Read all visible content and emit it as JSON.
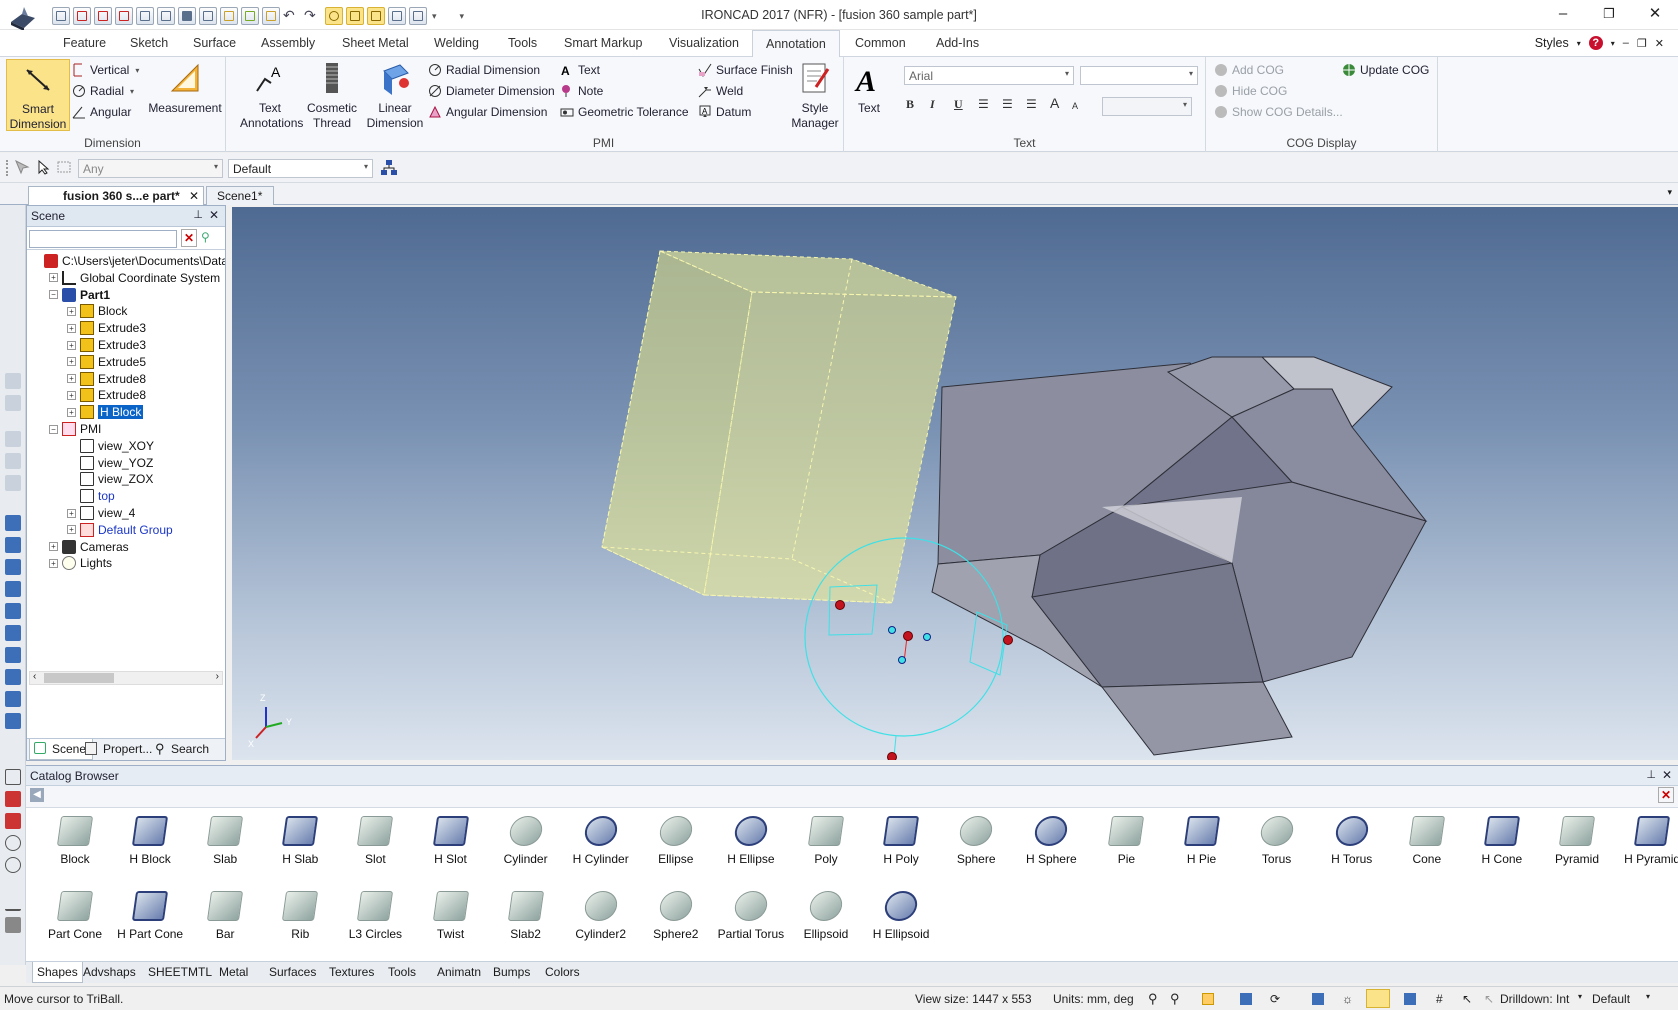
{
  "window": {
    "title": "IRONCAD 2017 (NFR) - [fusion 360 sample part*]",
    "minimize": "–",
    "restore": "❐",
    "close": "✕"
  },
  "ribbon_tabs": [
    "Feature",
    "Sketch",
    "Surface",
    "Assembly",
    "Sheet Metal",
    "Welding",
    "Tools",
    "Smart Markup",
    "Visualization",
    "Annotation",
    "Common",
    "Add-Ins"
  ],
  "styles_label": "Styles",
  "ribbon": {
    "dimension": {
      "smart_dimension_1": "Smart",
      "smart_dimension_2": "Dimension",
      "vertical": "Vertical",
      "radial": "Radial",
      "angular": "Angular",
      "measurement": "Measurement",
      "label": "Dimension"
    },
    "annot": {
      "text_annotations_1": "Text",
      "text_annotations_2": "Annotations",
      "cosmetic_thread_1": "Cosmetic",
      "cosmetic_thread_2": "Thread"
    },
    "pmi": {
      "linear_dimension_1": "Linear",
      "linear_dimension_2": "Dimension",
      "radial_dimension": "Radial Dimension",
      "diameter_dimension": "Diameter Dimension",
      "angular_dimension": "Angular Dimension",
      "text": "Text",
      "note": "Note",
      "geometric_tolerance": "Geometric Tolerance",
      "surface_finish": "Surface Finish",
      "weld": "Weld",
      "datum": "Datum",
      "style_manager_1": "Style",
      "style_manager_2": "Manager",
      "label": "PMI"
    },
    "text_group": {
      "text": "Text",
      "font": "Arial",
      "label": "Text"
    },
    "cog": {
      "add_cog": "Add COG",
      "hide_cog": "Hide COG",
      "show_cog_details": "Show COG Details...",
      "update_cog": "Update COG",
      "label": "COG Display"
    }
  },
  "filter": {
    "selection": "Any",
    "style": "Default"
  },
  "doc_tabs": [
    "fusion 360 s...e part*",
    "Scene1*"
  ],
  "scene": {
    "title": "Scene",
    "tree": [
      {
        "label": "C:\\Users\\jeter\\Documents\\Data",
        "level": 0,
        "expander": "",
        "color": "#111",
        "bold": false,
        "icon": "doc-icon"
      },
      {
        "label": "Global Coordinate System",
        "level": 1,
        "expander": "+",
        "color": "#111",
        "bold": false,
        "icon": "axes-icon"
      },
      {
        "label": "Part1",
        "level": 1,
        "expander": "−",
        "color": "#111",
        "bold": true,
        "icon": "part-icon"
      },
      {
        "label": "Block",
        "level": 2,
        "expander": "+",
        "color": "#111",
        "bold": false,
        "icon": "feature-icon"
      },
      {
        "label": "Extrude3",
        "level": 2,
        "expander": "+",
        "color": "#111",
        "bold": false,
        "icon": "feature-icon"
      },
      {
        "label": "Extrude3",
        "level": 2,
        "expander": "+",
        "color": "#111",
        "bold": false,
        "icon": "feature-icon"
      },
      {
        "label": "Extrude5",
        "level": 2,
        "expander": "+",
        "color": "#111",
        "bold": false,
        "icon": "feature-icon"
      },
      {
        "label": "Extrude8",
        "level": 2,
        "expander": "+",
        "color": "#111",
        "bold": false,
        "icon": "feature-icon"
      },
      {
        "label": "Extrude8",
        "level": 2,
        "expander": "+",
        "color": "#111",
        "bold": false,
        "icon": "feature-icon"
      },
      {
        "label": "H Block",
        "level": 2,
        "expander": "+",
        "color": "#fff",
        "bold": false,
        "icon": "feature-icon",
        "selected": true
      },
      {
        "label": "PMI",
        "level": 1,
        "expander": "−",
        "color": "#111",
        "bold": false,
        "icon": "pmi-icon"
      },
      {
        "label": "view_XOY",
        "level": 2,
        "expander": "",
        "color": "#111",
        "bold": false,
        "icon": "view-icon"
      },
      {
        "label": "view_YOZ",
        "level": 2,
        "expander": "",
        "color": "#111",
        "bold": false,
        "icon": "view-icon"
      },
      {
        "label": "view_ZOX",
        "level": 2,
        "expander": "",
        "color": "#111",
        "bold": false,
        "icon": "view-icon"
      },
      {
        "label": "top",
        "level": 2,
        "expander": "",
        "color": "#1a36c8",
        "bold": false,
        "icon": "view-icon"
      },
      {
        "label": "view_4",
        "level": 2,
        "expander": "+",
        "color": "#111",
        "bold": false,
        "icon": "view-icon"
      },
      {
        "label": "Default Group",
        "level": 2,
        "expander": "+",
        "color": "#1a36c8",
        "bold": false,
        "icon": "group-icon"
      },
      {
        "label": "Cameras",
        "level": 1,
        "expander": "+",
        "color": "#111",
        "bold": false,
        "icon": "camera-icon"
      },
      {
        "label": "Lights",
        "level": 1,
        "expander": "+",
        "color": "#111",
        "bold": false,
        "icon": "light-icon"
      }
    ],
    "tabs": [
      "Scene",
      "Propert...",
      "Search"
    ]
  },
  "viewport": {
    "axis_z": "Z",
    "axis_y": "Y",
    "axis_x": "X"
  },
  "catalog": {
    "title": "Catalog Browser",
    "items_row1": [
      "Block",
      "H Block",
      "Slab",
      "H Slab",
      "Slot",
      "H Slot",
      "Cylinder",
      "H Cylinder",
      "Ellipse",
      "H Ellipse",
      "Poly",
      "H Poly",
      "Sphere",
      "H Sphere",
      "Pie",
      "H Pie",
      "Torus",
      "H Torus",
      "Cone",
      "H Cone",
      "Pyramid",
      "H Pyramid"
    ],
    "items_row2": [
      "Part Cone",
      "H Part Cone",
      "Bar",
      "Rib",
      "L3 Circles",
      "Twist",
      "Slab2",
      "Cylinder2",
      "Sphere2",
      "Partial Torus",
      "Ellipsoid",
      "H Ellipsoid"
    ],
    "tabs": [
      "Shapes",
      "Advshaps",
      "SHEETMTL",
      "Metal",
      "Surfaces",
      "Textures",
      "Tools",
      "Animatn",
      "Bumps",
      "Colors"
    ]
  },
  "status": {
    "message": "Move cursor to TriBall.",
    "view_size": "View size: 1447 x  553",
    "units": "Units: mm, deg",
    "drilldown": "Drilldown: Int",
    "style": "Default"
  }
}
